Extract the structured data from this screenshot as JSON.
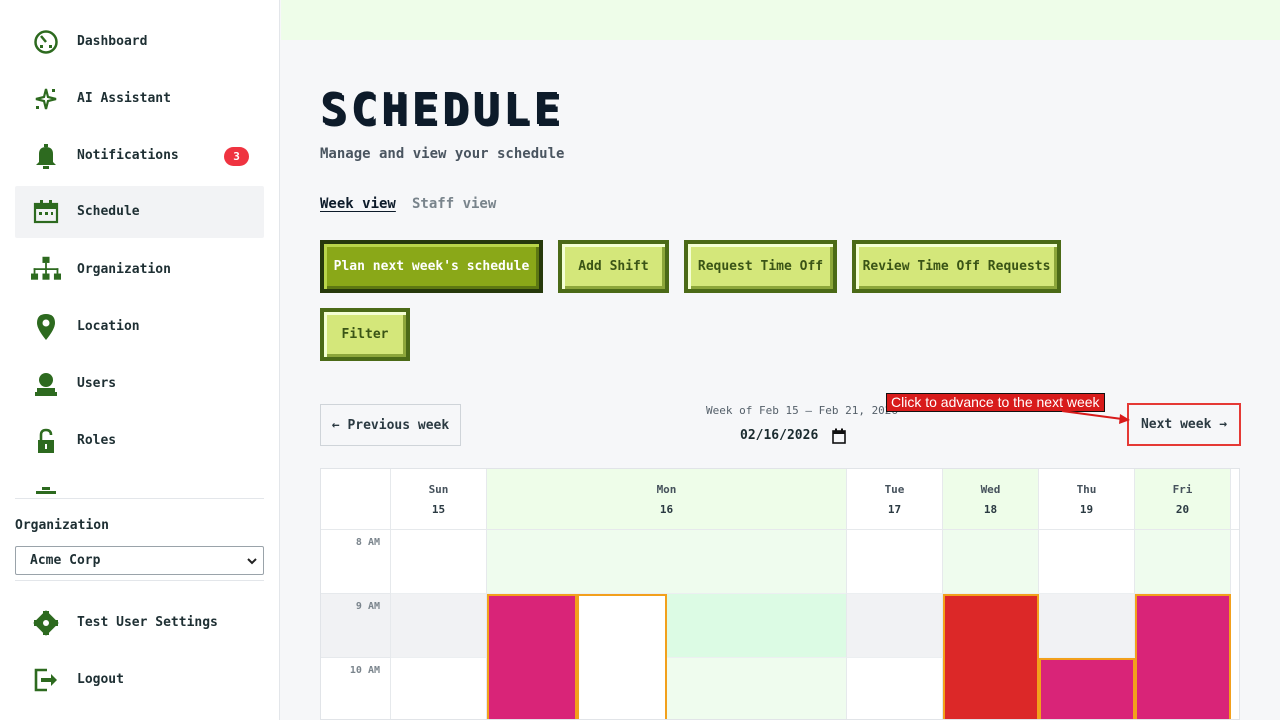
{
  "sidebar": {
    "items": [
      {
        "label": "Dashboard",
        "icon": "dashboard-icon"
      },
      {
        "label": "AI Assistant",
        "icon": "sparkle-icon"
      },
      {
        "label": "Notifications",
        "icon": "bell-icon",
        "badge": "3"
      },
      {
        "label": "Schedule",
        "icon": "calendar-icon",
        "active": true
      },
      {
        "label": "Organization",
        "icon": "org-chart-icon"
      },
      {
        "label": "Location",
        "icon": "map-pin-icon"
      },
      {
        "label": "Users",
        "icon": "user-icon"
      },
      {
        "label": "Roles",
        "icon": "lock-icon"
      }
    ],
    "organization_label": "Organization",
    "organization_value": "Acme Corp",
    "settings_label": "Test User Settings",
    "logout_label": "Logout"
  },
  "page": {
    "title": "SCHEDULE",
    "subtitle": "Manage and view your schedule",
    "tabs": [
      {
        "label": "Week view",
        "active": true
      },
      {
        "label": "Staff view",
        "active": false
      }
    ],
    "actions": {
      "plan": "Plan next week's schedule",
      "add_shift": "Add Shift",
      "request_time_off": "Request Time Off",
      "review_requests": "Review Time Off Requests",
      "filter": "Filter"
    },
    "week_nav": {
      "prev": "← Previous week",
      "range": "Week of Feb 15 – Feb 21, 2026",
      "date_value": "02/16/2026",
      "next": "Next week →",
      "annotation": "Click to advance to the next week"
    }
  },
  "calendar": {
    "days": [
      {
        "name": "Sun",
        "num": "15"
      },
      {
        "name": "Mon",
        "num": "16"
      },
      {
        "name": "Tue",
        "num": "17"
      },
      {
        "name": "Wed",
        "num": "18"
      },
      {
        "name": "Thu",
        "num": "19"
      },
      {
        "name": "Fri",
        "num": "20"
      }
    ],
    "times": [
      "8 AM",
      "9 AM",
      "10 AM"
    ]
  },
  "colors": {
    "accent": "#8aa818",
    "dark_green": "#26390c",
    "badge": "#ef3340",
    "shift_pink": "#d92478",
    "shift_red": "#dc2828",
    "shift_border": "#f2a01c",
    "highlight": "#eefde9"
  }
}
